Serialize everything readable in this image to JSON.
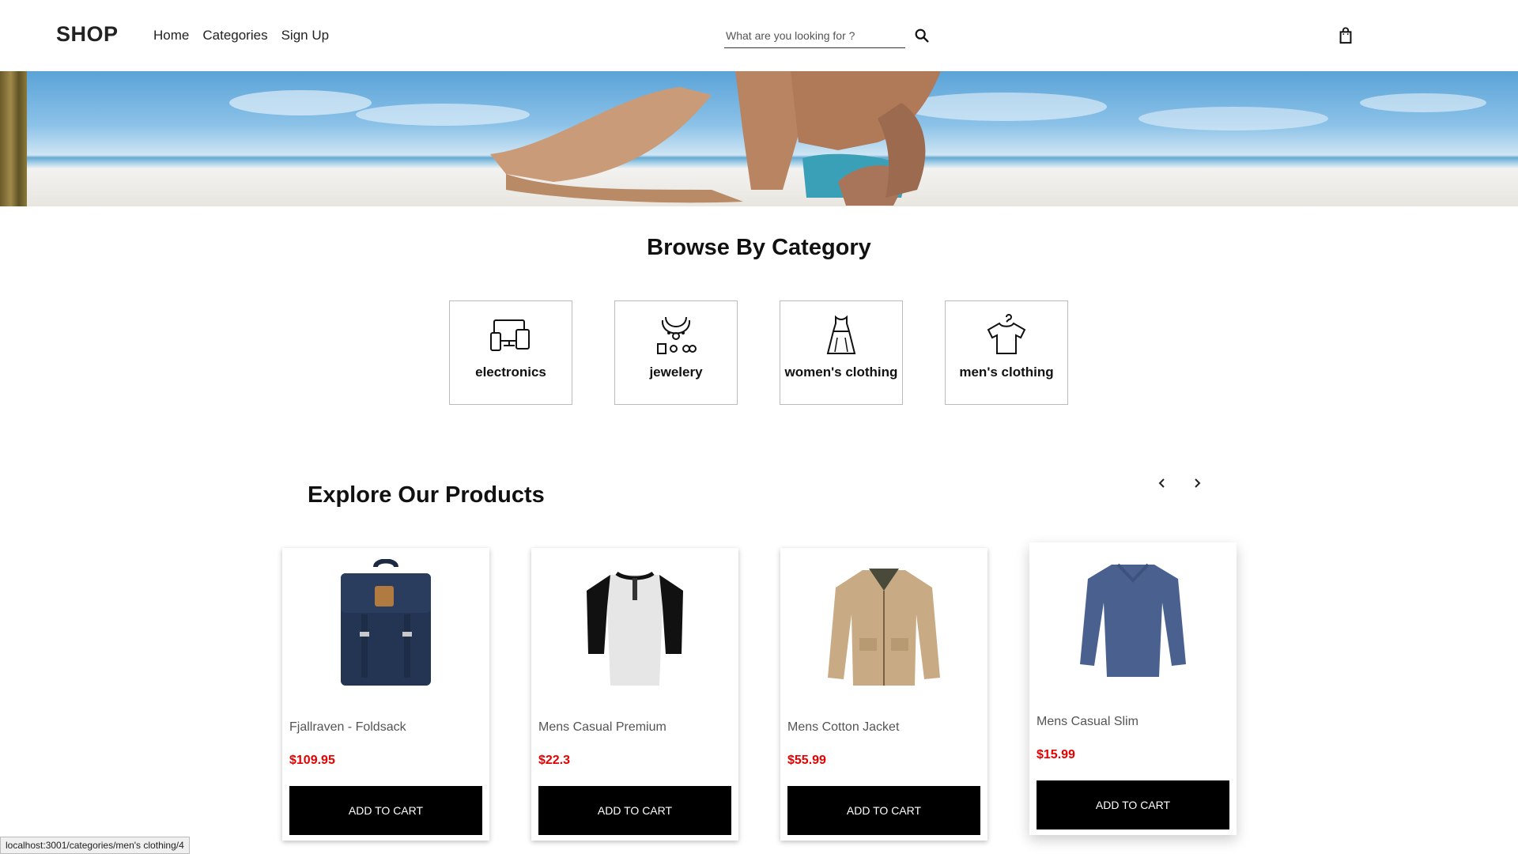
{
  "header": {
    "logo": "SHOP",
    "nav": [
      "Home",
      "Categories",
      "Sign Up"
    ],
    "search_placeholder": "What are you looking for ?",
    "search_icon": "search-icon",
    "cart_icon": "shopping-bag-icon"
  },
  "hero": {
    "image": "beach-couple-banner"
  },
  "categories": {
    "title": "Browse By Category",
    "items": [
      {
        "label": "electronics",
        "icon": "devices-icon"
      },
      {
        "label": "jewelery",
        "icon": "jewelry-icon"
      },
      {
        "label": "women's clothing",
        "icon": "dress-icon"
      },
      {
        "label": "men's clothing",
        "icon": "tshirt-icon"
      }
    ]
  },
  "products": {
    "title": "Explore Our Products",
    "prev_icon": "chevron-left-icon",
    "next_icon": "chevron-right-icon",
    "items": [
      {
        "name": "Fjallraven - Foldsack",
        "price": "$109.95",
        "button": "ADD TO CART",
        "image": "backpack-image"
      },
      {
        "name": "Mens Casual Premium",
        "price": "$22.3",
        "button": "ADD TO CART",
        "image": "raglan-tee-image"
      },
      {
        "name": "Mens Cotton Jacket",
        "price": "$55.99",
        "button": "ADD TO CART",
        "image": "jacket-image"
      },
      {
        "name": "Mens Casual Slim",
        "price": "$15.99",
        "button": "ADD TO CART",
        "image": "longsleeve-tee-image"
      }
    ]
  },
  "status_bar": {
    "url": "localhost:3001/categories/men's clothing/4"
  },
  "colors": {
    "price": "#e60000",
    "button_bg": "#000000",
    "button_text": "#ffffff"
  }
}
